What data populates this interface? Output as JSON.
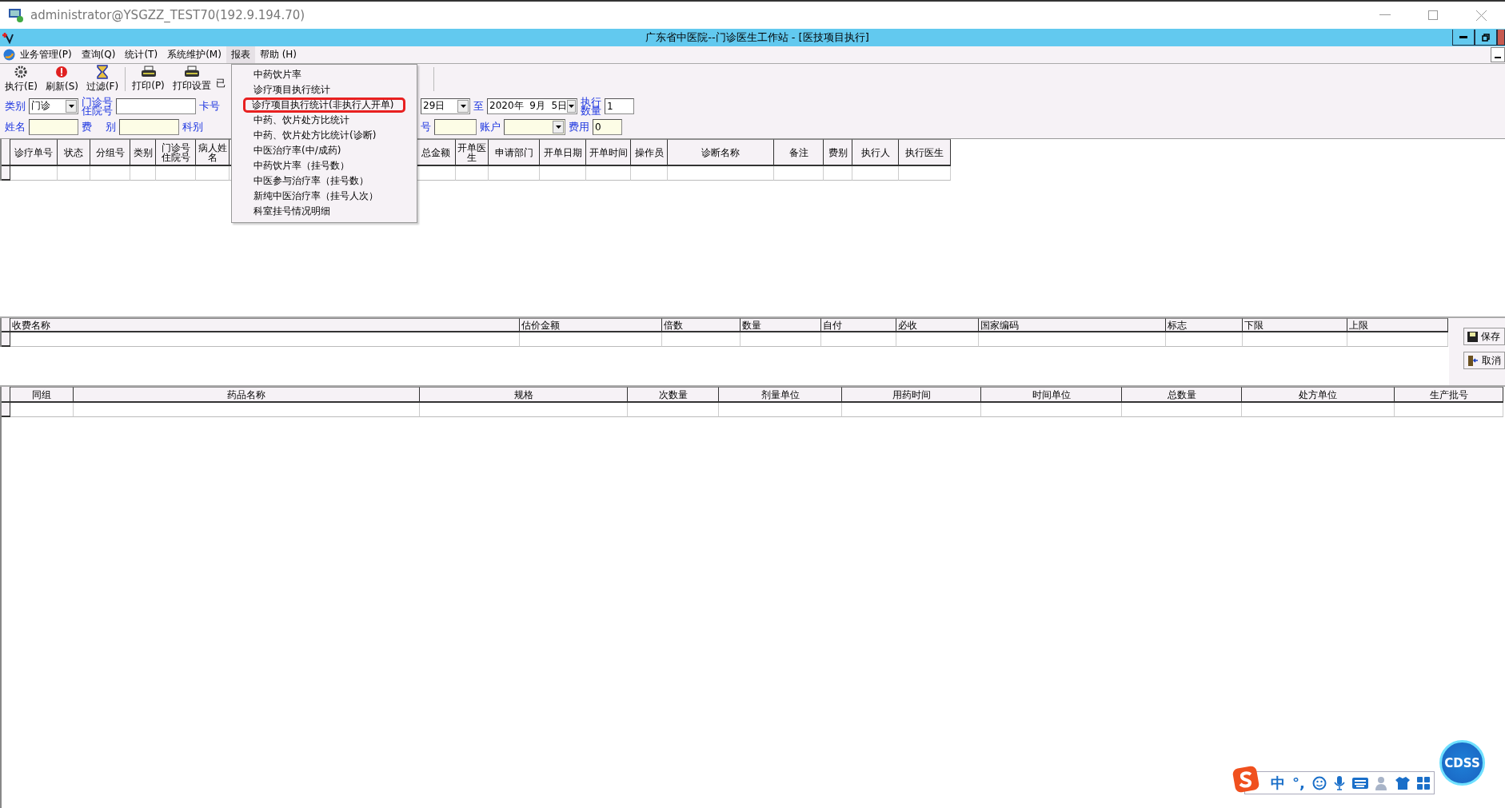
{
  "remote_window": {
    "title": "administrator@YSGZZ_TEST70(192.9.194.70)"
  },
  "app_window": {
    "title": "广东省中医院--门诊医生工作站 - [医技项目执行]"
  },
  "menu_bar": [
    {
      "label": "业务管理(P)",
      "selected": false
    },
    {
      "label": "查询(Q)",
      "selected": false
    },
    {
      "label": "统计(T)",
      "selected": false
    },
    {
      "label": "系统维护(M)",
      "selected": false
    },
    {
      "label": "报表",
      "selected": true
    },
    {
      "label": "帮助 (H)",
      "selected": false
    }
  ],
  "report_menu": [
    {
      "label": "中药饮片率",
      "selected": false
    },
    {
      "label": "诊疗项目执行统计",
      "selected": false
    },
    {
      "label": "诊疗项目执行统计(非执行人开单)",
      "selected": true
    },
    {
      "label": "中药、饮片处方比统计",
      "selected": false
    },
    {
      "label": "中药、饮片处方比统计(诊断)",
      "selected": false
    },
    {
      "label": "中医治疗率(中/成药)",
      "selected": false
    },
    {
      "label": "中药饮片率（挂号数）",
      "selected": false
    },
    {
      "label": "中医参与治疗率（挂号数）",
      "selected": false
    },
    {
      "label": "新纯中医治疗率（挂号人次）",
      "selected": false
    },
    {
      "label": "科室挂号情况明细",
      "selected": false
    }
  ],
  "toolbar": [
    [
      {
        "label": "执行(E)",
        "kind": "gear"
      },
      {
        "label": "刷新(S)",
        "kind": "refresh"
      },
      {
        "label": "过滤(F)",
        "kind": "hourglass"
      }
    ],
    [
      {
        "label": "打印(P)",
        "kind": "printer"
      },
      {
        "label": "打印设置",
        "kind": "printer"
      },
      {
        "label": "已",
        "kind": "text"
      }
    ]
  ],
  "filters": [
    {
      "left": [
        {
          "kind": "label",
          "text": "类别"
        },
        {
          "kind": "select",
          "value": "门诊",
          "highlighted": false
        },
        {
          "kind": "label",
          "lines": [
            "门诊号",
            "住院号"
          ]
        },
        {
          "kind": "input",
          "highlighted": false
        },
        {
          "kind": "label",
          "text": "卡号"
        }
      ],
      "right": [
        {
          "kind": "select",
          "value": "29日",
          "highlighted": false
        },
        {
          "kind": "label",
          "text": "至"
        },
        {
          "kind": "select",
          "value": "2020年  9月  5日",
          "highlighted": false
        },
        {
          "kind": "label",
          "lines": [
            "执行",
            "数量"
          ]
        },
        {
          "kind": "input",
          "value": "1",
          "highlighted": false
        }
      ]
    },
    {
      "left": [
        {
          "kind": "label",
          "text": "姓名"
        },
        {
          "kind": "input",
          "highlighted": true
        },
        {
          "kind": "label",
          "text": "费    别"
        },
        {
          "kind": "input",
          "highlighted": true
        },
        {
          "kind": "label",
          "text": "科别"
        }
      ],
      "right": [
        {
          "kind": "label",
          "text": "号"
        },
        {
          "kind": "input",
          "highlighted": true
        },
        {
          "kind": "label",
          "text": "账户"
        },
        {
          "kind": "select",
          "highlighted": true
        },
        {
          "kind": "label",
          "text": "费用"
        },
        {
          "kind": "input",
          "value": "0",
          "highlighted": true
        }
      ]
    }
  ],
  "order_grid": {
    "columns_left": [
      "诊疗单号",
      "状态",
      "分组号",
      "类别",
      "门诊号住院号",
      "病人姓名"
    ],
    "columns_right": [
      "总金额",
      "开单医生",
      "申请部门",
      "开单日期",
      "开单时间",
      "操作员",
      "诊断名称",
      "备注",
      "费别",
      "执行人",
      "执行医生"
    ]
  },
  "fee_grid": {
    "columns": [
      "收费名称",
      "估价金额",
      "倍数",
      "数量",
      "自付",
      "必收",
      "国家编码",
      "标志",
      "下限",
      "上限"
    ]
  },
  "side_buttons": [
    {
      "label": "保存",
      "kind": "save"
    },
    {
      "label": "取消",
      "kind": "exit"
    }
  ],
  "drug_grid": {
    "columns": [
      "同组",
      "药品名称",
      "规格",
      "次数量",
      "剂量单位",
      "用药时间",
      "时间单位",
      "总数量",
      "处方单位",
      "生产批号"
    ]
  },
  "ime_bar": {
    "mode": "中",
    "punctuation": "°,"
  },
  "cdss_button": {
    "label": "CDSS"
  }
}
